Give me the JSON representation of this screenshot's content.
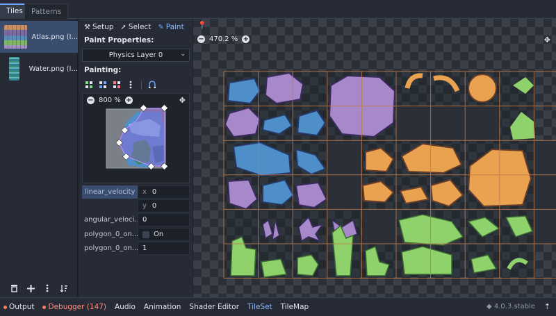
{
  "top_tabs": [
    "Tiles",
    "Patterns"
  ],
  "sources": [
    {
      "label": "Atlas.png (I..."
    },
    {
      "label": "Water.png (I..."
    }
  ],
  "modes": {
    "setup": "Setup",
    "select": "Select",
    "paint": "Paint"
  },
  "paint_properties": {
    "title": "Paint Properties:",
    "layer": "Physics Layer 0"
  },
  "painting": {
    "title": "Painting:",
    "zoom": "800 %"
  },
  "properties": {
    "linear_velocity": {
      "name": "linear_velocity",
      "x": "0",
      "y": "0"
    },
    "angular_velocity": {
      "name": "angular_veloci...",
      "value": "0"
    },
    "polygon_0_one_way": {
      "name": "polygon_0_on...",
      "value": "On"
    },
    "polygon_0_one_way_margin": {
      "name": "polygon_0_on...",
      "value": "1"
    }
  },
  "axes": {
    "x": "x",
    "y": "y"
  },
  "viewport": {
    "zoom": "470.2 %"
  },
  "bottom_tabs": [
    {
      "label": "Output"
    },
    {
      "label": "Debugger (147)"
    },
    {
      "label": "Audio"
    },
    {
      "label": "Animation"
    },
    {
      "label": "Shader Editor"
    },
    {
      "label": "TileSet"
    },
    {
      "label": "TileMap"
    }
  ],
  "version": "4.0.3.stable",
  "colors": {
    "accent": "#6ea5ff",
    "selected_bg": "#3b4d6e",
    "debugger_red": "#ff8c7a",
    "tile_blue": "#4f8fc9",
    "tile_purple": "#a788c9",
    "tile_orange": "#e9a24f",
    "tile_green": "#8fd16b",
    "grid_line": "#c07a4a"
  }
}
